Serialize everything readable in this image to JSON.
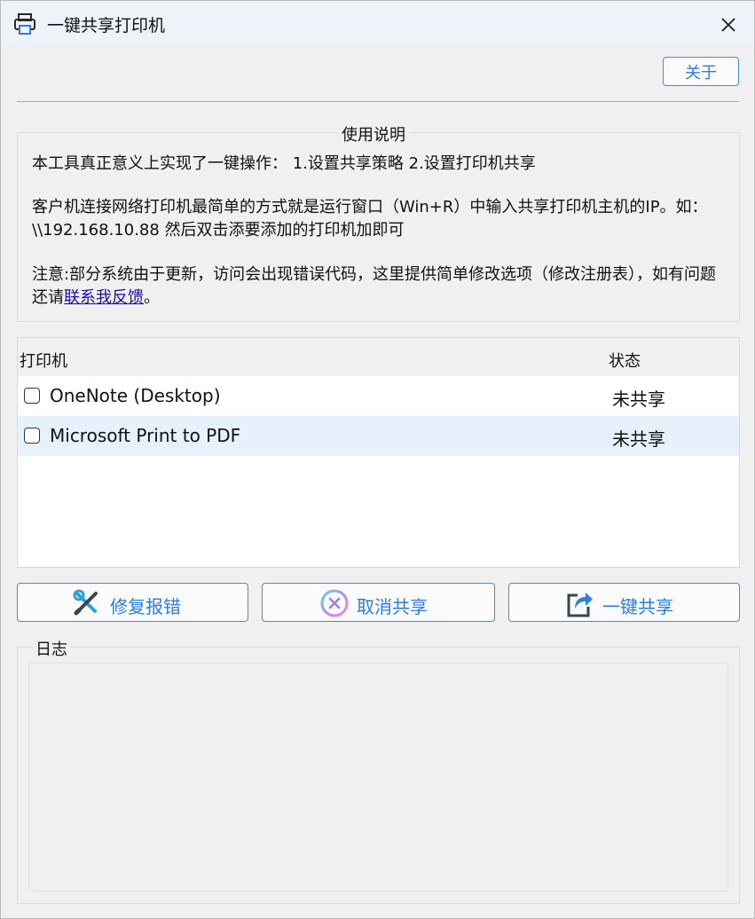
{
  "window": {
    "title": "一键共享打印机",
    "about_label": "关于"
  },
  "instructions": {
    "legend": "使用说明",
    "line1": "本工具真正意义上实现了一键操作： 1.设置共享策略 2.设置打印机共享",
    "line2": "客户机连接网络打印机最简单的方式就是运行窗口（Win+R）中输入共享打印机主机的IP。如：\\\\192.168.10.88 然后双击添要添加的打印机加即可",
    "line3_prefix": "注意:部分系统由于更新，访问会出现错误代码，这里提供简单修改选项（修改注册表），如有问题还请",
    "line3_link": "联系我反馈",
    "line3_suffix": "。"
  },
  "printer_table": {
    "columns": [
      "打印机",
      "状态"
    ],
    "rows": [
      {
        "name": "OneNote (Desktop)",
        "status": "未共享",
        "checked": false
      },
      {
        "name": "Microsoft Print to PDF",
        "status": "未共享",
        "checked": false
      }
    ]
  },
  "actions": {
    "repair_label": "修复报错",
    "cancel_label": "取消共享",
    "share_label": "一键共享"
  },
  "log": {
    "legend": "日志",
    "content": ""
  },
  "icons": {
    "app": "printer-icon",
    "close": "close-icon",
    "repair": "wrench-screwdriver-icon",
    "cancel": "cancel-circle-icon",
    "share": "share-arrow-icon"
  },
  "colors": {
    "accent": "#3a8ee6",
    "accent_text": "#2b7de0",
    "link": "#1a0dab",
    "selected_row": "#e6f1fb"
  }
}
